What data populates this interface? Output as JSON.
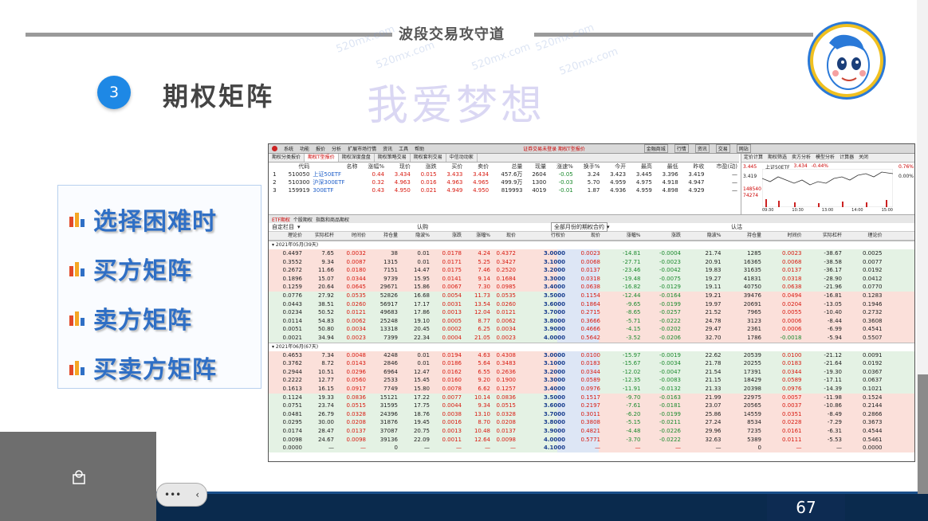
{
  "slide": {
    "title": "波段交易攻守道",
    "watermark": "520mx.com",
    "watermark_big": "我爱梦想",
    "section_number": "3",
    "section_title": "期权矩阵",
    "page_number": "67",
    "menu": [
      {
        "label": "选择困难时"
      },
      {
        "label": "买方矩阵"
      },
      {
        "label": "卖方矩阵"
      },
      {
        "label": "买卖方矩阵"
      }
    ]
  },
  "app": {
    "menubar": [
      "系统",
      "功能",
      "报价",
      "分析",
      "扩展市场行情",
      "资讯",
      "工具",
      "帮助"
    ],
    "window_title": "证券交易未登录 期权T型报价",
    "right_buttons": [
      "金融商城",
      "行情",
      "资讯",
      "交易",
      "网站"
    ],
    "tabs": [
      "期权分类报价",
      "期权T型报价",
      "期权深度盘盘",
      "期权策略交易",
      "期权套利交易",
      "中信动动家"
    ],
    "quote_headers": [
      "",
      "代码",
      "名称",
      "涨幅%",
      "现价",
      "涨跌",
      "买价",
      "卖价",
      "总量",
      "现量",
      "涨速%",
      "换手%",
      "今开",
      "最高",
      "最低",
      "昨收",
      "市盈(动)"
    ],
    "quote_rows": [
      [
        "1",
        "510050",
        "上证50ETF",
        "0.44",
        "3.434",
        "0.015",
        "3.433",
        "3.434",
        "457.6万",
        "2604",
        "-0.05",
        "3.24",
        "3.423",
        "3.445",
        "3.396",
        "3.419",
        "—"
      ],
      [
        "2",
        "510300",
        "沪深300ETF",
        "0.32",
        "4.963",
        "0.016",
        "4.963",
        "4.965",
        "499.9万",
        "1300",
        "-0.03",
        "5.70",
        "4.959",
        "4.975",
        "4.918",
        "4.947",
        "—"
      ],
      [
        "3",
        "159919",
        "300ETF",
        "0.43",
        "4.950",
        "0.021",
        "4.949",
        "4.950",
        "819993",
        "4019",
        "-0.01",
        "1.87",
        "4.936",
        "4.959",
        "4.898",
        "4.929",
        "—"
      ]
    ],
    "mini_tabs": [
      "定价计算",
      "期权筛选",
      "卖方分析",
      "模型分析",
      "计算器",
      "关闭"
    ],
    "mini_chart": {
      "label": "上证50ETF",
      "price": "3.434",
      "chg": "-0.44%",
      "hi": "3.445",
      "lo": "3.419",
      "pct_hi": "0.76%",
      "pct_mid": "0.00%",
      "vol1": "148540",
      "vol2": "74274",
      "times": [
        "09:30",
        "10:30",
        "13:00",
        "14:00",
        "15:00"
      ]
    },
    "subtabs": [
      "ETF期权",
      "个股期权",
      "指数和商品期权"
    ],
    "selector": {
      "left": "自定栏目",
      "center": "认购",
      "month": "全部月份的期权合约",
      "right": "认沽"
    },
    "col_headers_left": [
      "理论价",
      "实际杠杆",
      "时间价",
      "持仓量",
      "隐波%",
      "涨跌",
      "涨幅%",
      "现价"
    ],
    "col_headers_mid": "行权价",
    "col_headers_right": [
      "现价",
      "涨幅%",
      "涨跌",
      "隐波%",
      "持仓量",
      "时间价",
      "实际杠杆",
      "理论价"
    ],
    "groups": [
      {
        "label": "2021年05月(39天)",
        "rows": [
          {
            "L": [
              "0.4497",
              "7.65",
              "0.0032",
              "38",
              "0.01",
              "0.0178",
              "4.24",
              "0.4372"
            ],
            "K": "3.0000",
            "R": [
              "0.0023",
              "-14.81",
              "-0.0004",
              "21.74",
              "1285",
              "0.0023",
              "-38.67",
              "0.0025"
            ]
          },
          {
            "L": [
              "0.3552",
              "9.34",
              "0.0087",
              "1315",
              "0.01",
              "0.0171",
              "5.25",
              "0.3427"
            ],
            "K": "3.1000",
            "R": [
              "0.0068",
              "-27.71",
              "-0.0023",
              "20.91",
              "16365",
              "0.0068",
              "-38.58",
              "0.0077"
            ]
          },
          {
            "L": [
              "0.2672",
              "11.66",
              "0.0180",
              "7151",
              "14.47",
              "0.0175",
              "7.46",
              "0.2520"
            ],
            "K": "3.2000",
            "R": [
              "0.0137",
              "-23.46",
              "-0.0042",
              "19.83",
              "31635",
              "0.0137",
              "-36.17",
              "0.0192"
            ]
          },
          {
            "L": [
              "0.1896",
              "15.07",
              "0.0344",
              "9739",
              "15.95",
              "0.0141",
              "9.14",
              "0.1684"
            ],
            "K": "3.3000",
            "R": [
              "0.0318",
              "-19.48",
              "-0.0075",
              "19.27",
              "41831",
              "0.0318",
              "-28.90",
              "0.0412"
            ]
          },
          {
            "L": [
              "0.1259",
              "20.64",
              "0.0645",
              "29671",
              "15.86",
              "0.0067",
              "7.30",
              "0.0985"
            ],
            "K": "3.4000",
            "R": [
              "0.0638",
              "-16.82",
              "-0.0129",
              "19.11",
              "40750",
              "0.0638",
              "-21.96",
              "0.0770"
            ]
          },
          {
            "L": [
              "0.0776",
              "27.92",
              "0.0535",
              "52826",
              "16.68",
              "0.0054",
              "11.73",
              "0.0535"
            ],
            "K": "3.5000",
            "R": [
              "0.1154",
              "-12.44",
              "-0.0164",
              "19.21",
              "39476",
              "0.0494",
              "-16.81",
              "0.1283"
            ]
          },
          {
            "L": [
              "0.0443",
              "38.51",
              "0.0260",
              "56917",
              "17.17",
              "0.0031",
              "13.54",
              "0.0260"
            ],
            "K": "3.6000",
            "R": [
              "0.1864",
              "-9.65",
              "-0.0199",
              "19.97",
              "20691",
              "0.0204",
              "-13.05",
              "0.1946"
            ]
          },
          {
            "L": [
              "0.0234",
              "50.52",
              "0.0121",
              "49683",
              "17.86",
              "0.0013",
              "12.04",
              "0.0121"
            ],
            "K": "3.7000",
            "R": [
              "0.2715",
              "-8.65",
              "-0.0257",
              "21.52",
              "7965",
              "0.0055",
              "-10.40",
              "0.2732"
            ]
          },
          {
            "L": [
              "0.0114",
              "54.83",
              "0.0062",
              "25248",
              "19.10",
              "0.0005",
              "8.77",
              "0.0062"
            ],
            "K": "3.8000",
            "R": [
              "0.3666",
              "-5.71",
              "-0.0222",
              "24.78",
              "3123",
              "0.0006",
              "-8.44",
              "0.3608"
            ]
          },
          {
            "L": [
              "0.0051",
              "50.80",
              "0.0034",
              "13318",
              "20.45",
              "0.0002",
              "6.25",
              "0.0034"
            ],
            "K": "3.9000",
            "R": [
              "0.4666",
              "-4.15",
              "-0.0202",
              "29.47",
              "2361",
              "0.0006",
              "-6.99",
              "0.4541"
            ]
          },
          {
            "L": [
              "0.0021",
              "34.94",
              "0.0023",
              "7399",
              "22.34",
              "0.0004",
              "21.05",
              "0.0023"
            ],
            "K": "4.0000",
            "R": [
              "0.5642",
              "-3.52",
              "-0.0206",
              "32.70",
              "1786",
              "-0.0018",
              "-5.94",
              "0.5507"
            ]
          }
        ]
      },
      {
        "label": "2021年06月(67天)",
        "rows": [
          {
            "L": [
              "0.4653",
              "7.34",
              "0.0048",
              "4248",
              "0.01",
              "0.0194",
              "4.63",
              "0.4308"
            ],
            "K": "3.0000",
            "R": [
              "0.0100",
              "-15.97",
              "-0.0019",
              "22.62",
              "20539",
              "0.0100",
              "-21.12",
              "0.0091"
            ]
          },
          {
            "L": [
              "0.3762",
              "8.72",
              "0.0143",
              "2846",
              "0.01",
              "0.0186",
              "5.64",
              "0.3483"
            ],
            "K": "3.1000",
            "R": [
              "0.0183",
              "-15.67",
              "-0.0034",
              "21.78",
              "20255",
              "0.0183",
              "-21.64",
              "0.0192"
            ]
          },
          {
            "L": [
              "0.2944",
              "10.51",
              "0.0296",
              "6964",
              "12.47",
              "0.0162",
              "6.55",
              "0.2636"
            ],
            "K": "3.2000",
            "R": [
              "0.0344",
              "-12.02",
              "-0.0047",
              "21.54",
              "17391",
              "0.0344",
              "-19.30",
              "0.0367"
            ]
          },
          {
            "L": [
              "0.2222",
              "12.77",
              "0.0560",
              "2533",
              "15.45",
              "0.0160",
              "9.20",
              "0.1900"
            ],
            "K": "3.3000",
            "R": [
              "0.0589",
              "-12.35",
              "-0.0083",
              "21.15",
              "18429",
              "0.0589",
              "-17.11",
              "0.0637"
            ]
          },
          {
            "L": [
              "0.1613",
              "16.15",
              "0.0917",
              "7749",
              "15.80",
              "0.0078",
              "6.62",
              "0.1257"
            ],
            "K": "3.4000",
            "R": [
              "0.0976",
              "-11.91",
              "-0.0132",
              "21.33",
              "20398",
              "0.0976",
              "-14.39",
              "0.1021"
            ]
          },
          {
            "L": [
              "0.1124",
              "19.33",
              "0.0836",
              "15121",
              "17.22",
              "0.0077",
              "10.14",
              "0.0836"
            ],
            "K": "3.5000",
            "R": [
              "0.1517",
              "-9.70",
              "-0.0163",
              "21.99",
              "22975",
              "0.0057",
              "-11.98",
              "0.1524"
            ]
          },
          {
            "L": [
              "0.0751",
              "23.74",
              "0.0515",
              "31595",
              "17.75",
              "0.0044",
              "9.34",
              "0.0515"
            ],
            "K": "3.6000",
            "R": [
              "0.2197",
              "-7.61",
              "-0.0181",
              "23.07",
              "20565",
              "0.0037",
              "-10.86",
              "0.2144"
            ]
          },
          {
            "L": [
              "0.0481",
              "26.79",
              "0.0328",
              "24396",
              "18.76",
              "0.0038",
              "13.10",
              "0.0328"
            ],
            "K": "3.7000",
            "R": [
              "0.3011",
              "-6.20",
              "-0.0199",
              "25.86",
              "14559",
              "0.0351",
              "-8.49",
              "0.2866"
            ]
          },
          {
            "L": [
              "0.0295",
              "30.00",
              "0.0208",
              "31876",
              "19.45",
              "0.0016",
              "8.70",
              "0.0208"
            ],
            "K": "3.8000",
            "R": [
              "0.3808",
              "-5.15",
              "-0.0211",
              "27.24",
              "8534",
              "0.0228",
              "-7.29",
              "0.3673"
            ]
          },
          {
            "L": [
              "0.0174",
              "28.47",
              "0.0137",
              "37087",
              "20.75",
              "0.0013",
              "10.48",
              "0.0137"
            ],
            "K": "3.9000",
            "R": [
              "0.4821",
              "-4.48",
              "-0.0226",
              "29.96",
              "7235",
              "0.0161",
              "-6.31",
              "0.4544"
            ]
          },
          {
            "L": [
              "0.0098",
              "24.67",
              "0.0098",
              "39136",
              "22.09",
              "0.0011",
              "12.64",
              "0.0098"
            ],
            "K": "4.0000",
            "R": [
              "0.5771",
              "-3.70",
              "-0.0222",
              "32.63",
              "5389",
              "0.0111",
              "-5.53",
              "0.5461"
            ]
          },
          {
            "L": [
              "0.0000",
              "—",
              "—",
              "0",
              "—",
              "—",
              "—",
              "—"
            ],
            "K": "4.1000",
            "R": [
              "—",
              "—",
              "—",
              "—",
              "0",
              "—",
              "—",
              "0.0000"
            ]
          }
        ]
      }
    ]
  },
  "colors": {
    "accent_blue": "#1e88e5",
    "menu_text": "#2f6fc5",
    "up_red": "#d8190f",
    "down_green": "#1c8a2e",
    "itm_call_bg": "#fbe0da",
    "itm_put_bg": "#e4f2e4",
    "otm_call_bg": "#e4f2e4",
    "otm_put_bg": "#fbe0da",
    "footer_navy": "#0a2a4d"
  }
}
